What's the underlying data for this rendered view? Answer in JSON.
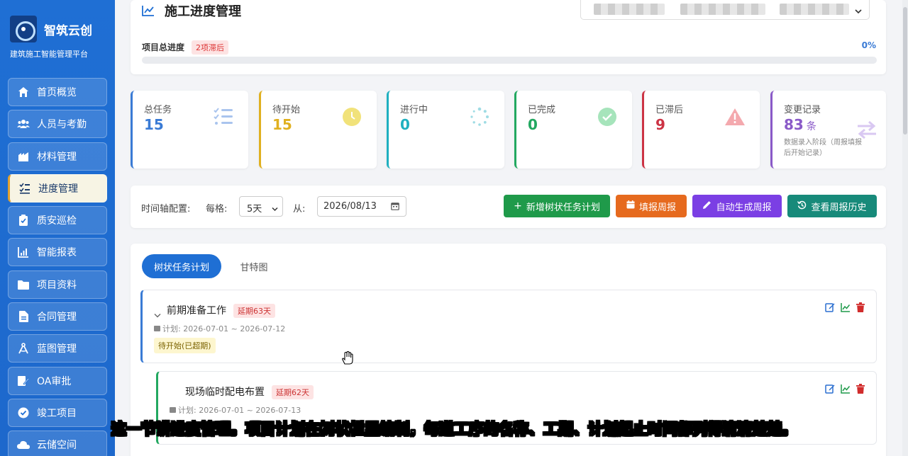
{
  "brand": {
    "name": "智筑云创",
    "subtitle": "建筑施工智能管理平台"
  },
  "nav": [
    {
      "label": "首页概览",
      "icon": "home-icon"
    },
    {
      "label": "人员与考勤",
      "icon": "users-icon"
    },
    {
      "label": "材料管理",
      "icon": "warehouse-icon"
    },
    {
      "label": "进度管理",
      "icon": "tasks-icon",
      "active": true
    },
    {
      "label": "质安巡检",
      "icon": "clipboard-check-icon"
    },
    {
      "label": "智能报表",
      "icon": "chart-icon"
    },
    {
      "label": "项目资料",
      "icon": "folder-icon"
    },
    {
      "label": "合同管理",
      "icon": "document-icon"
    },
    {
      "label": "蓝图管理",
      "icon": "compass-icon"
    },
    {
      "label": "OA审批",
      "icon": "edit-document-icon"
    },
    {
      "label": "竣工项目",
      "icon": "check-circle-icon"
    },
    {
      "label": "云储空间",
      "icon": "cloud-icon"
    }
  ],
  "header": {
    "title": "施工进度管理"
  },
  "progress": {
    "label": "项目总进度",
    "badge": "2项滞后",
    "percent_text": "0%",
    "value": 0
  },
  "stats": [
    {
      "label": "总任务",
      "value": "15",
      "color": "#3a7bd5",
      "icon": "list-check-icon"
    },
    {
      "label": "待开始",
      "value": "15",
      "color": "#e0b020",
      "icon": "clock-icon"
    },
    {
      "label": "进行中",
      "value": "0",
      "color": "#1fb0c0",
      "icon": "spinner-icon"
    },
    {
      "label": "已完成",
      "value": "0",
      "color": "#22a860",
      "icon": "check-circle-icon"
    },
    {
      "label": "已滞后",
      "value": "9",
      "color": "#cc3344",
      "icon": "warning-icon"
    },
    {
      "label": "变更记录",
      "value": "83",
      "unit": "条",
      "note": "数据录入阶段（周报填报后开始记录）",
      "color": "#8a5ac8",
      "icon": "exchange-icon"
    }
  ],
  "toolbar": {
    "timeline_label": "时间轴配置:",
    "interval_label": "每格:",
    "interval_value": "5天",
    "from_label": "从:",
    "from_date": "2026/08/13",
    "buttons": [
      {
        "label": "新增树状任务计划",
        "color": "#1f9a4a",
        "icon": "plus-icon"
      },
      {
        "label": "填报周报",
        "color": "#e66a1e",
        "icon": "calendar-icon"
      },
      {
        "label": "自动生成周报",
        "color": "#7b3fe4",
        "icon": "pencil-icon"
      },
      {
        "label": "查看周报历史",
        "color": "#178a7a",
        "icon": "history-icon"
      }
    ]
  },
  "tabs": [
    "树状任务计划",
    "甘特图"
  ],
  "tasks": [
    {
      "name": "前期准备工作",
      "delay": "延期63天",
      "plan": "计划: 2026-07-01 ~ 2026-07-12",
      "status": "待开始(已超期)"
    },
    {
      "name": "现场临时配电布置",
      "delay": "延期62天",
      "plan": "计划: 2026-07-01 ~ 2026-07-13"
    }
  ],
  "subtitle": "这一节讲进度管理。项目计划在树状栏里编制，每道工序的名称、工期、计划起止时间都列得清清楚楚。"
}
